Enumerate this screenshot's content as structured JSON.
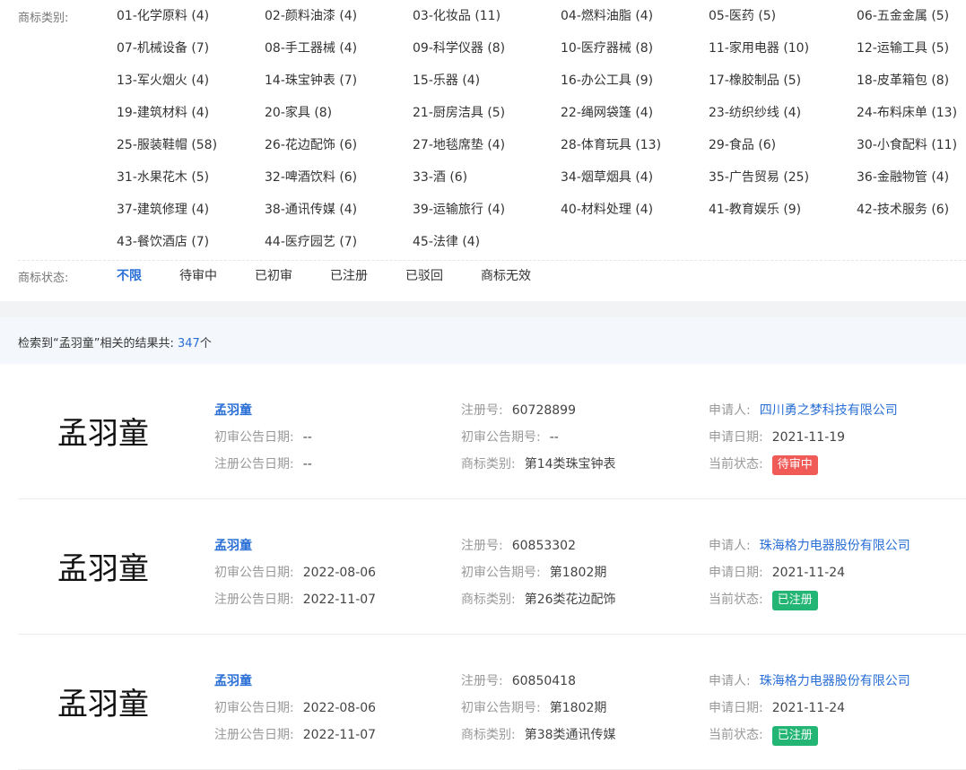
{
  "filters": {
    "category_label": "商标类别:",
    "categories": [
      "01-化学原料 (4)",
      "02-颜料油漆 (4)",
      "03-化妆品 (11)",
      "04-燃料油脂 (4)",
      "05-医药 (5)",
      "06-五金金属 (5)",
      "07-机械设备 (7)",
      "08-手工器械 (4)",
      "09-科学仪器 (8)",
      "10-医疗器械 (8)",
      "11-家用电器 (10)",
      "12-运输工具 (5)",
      "13-军火烟火 (4)",
      "14-珠宝钟表 (7)",
      "15-乐器 (4)",
      "16-办公工具 (9)",
      "17-橡胶制品 (5)",
      "18-皮革箱包 (8)",
      "19-建筑材料 (4)",
      "20-家具 (8)",
      "21-厨房洁具 (5)",
      "22-绳网袋篷 (4)",
      "23-纺织纱线 (4)",
      "24-布料床单 (13)",
      "25-服装鞋帽 (58)",
      "26-花边配饰 (6)",
      "27-地毯席垫 (4)",
      "28-体育玩具 (13)",
      "29-食品 (6)",
      "30-小食配料 (11)",
      "31-水果花木 (5)",
      "32-啤酒饮料 (6)",
      "33-酒 (6)",
      "34-烟草烟具 (4)",
      "35-广告贸易 (25)",
      "36-金融物管 (4)",
      "37-建筑修理 (4)",
      "38-通讯传媒 (4)",
      "39-运输旅行 (4)",
      "40-材料处理 (4)",
      "41-教育娱乐 (9)",
      "42-技术服务 (6)",
      "43-餐饮酒店 (7)",
      "44-医疗园艺 (7)",
      "45-法律 (4)"
    ],
    "status_label": "商标状态:",
    "statuses": [
      "不限",
      "待审中",
      "已初审",
      "已注册",
      "已驳回",
      "商标无效"
    ],
    "active_status": "不限"
  },
  "results": {
    "prefix": "检索到“孟羽童”相关的结果共:",
    "count": "347",
    "suffix": "个"
  },
  "labels": {
    "reg_no": "注册号:",
    "applicant": "申请人:",
    "prelim_date": "初审公告日期:",
    "prelim_no": "初审公告期号:",
    "apply_date": "申请日期:",
    "reg_date": "注册公告日期:",
    "category": "商标类别:",
    "status": "当前状态:"
  },
  "colors": {
    "pending": "#f05a57",
    "registered": "#22b573",
    "accent": "#2a6fd6"
  },
  "cards": [
    {
      "image_text": "孟羽童",
      "name": "孟羽童",
      "reg_no": "60728899",
      "applicant": "四川勇之梦科技有限公司",
      "prelim_date": "--",
      "prelim_no": "--",
      "apply_date": "2021-11-19",
      "reg_date": "--",
      "category": "第14类珠宝钟表",
      "status": "待审中",
      "status_type": "pending"
    },
    {
      "image_text": "孟羽童",
      "name": "孟羽童",
      "reg_no": "60853302",
      "applicant": "珠海格力电器股份有限公司",
      "prelim_date": "2022-08-06",
      "prelim_no": "第1802期",
      "apply_date": "2021-11-24",
      "reg_date": "2022-11-07",
      "category": "第26类花边配饰",
      "status": "已注册",
      "status_type": "registered"
    },
    {
      "image_text": "孟羽童",
      "name": "孟羽童",
      "reg_no": "60850418",
      "applicant": "珠海格力电器股份有限公司",
      "prelim_date": "2022-08-06",
      "prelim_no": "第1802期",
      "apply_date": "2021-11-24",
      "reg_date": "2022-11-07",
      "category": "第38类通讯传媒",
      "status": "已注册",
      "status_type": "registered"
    }
  ]
}
